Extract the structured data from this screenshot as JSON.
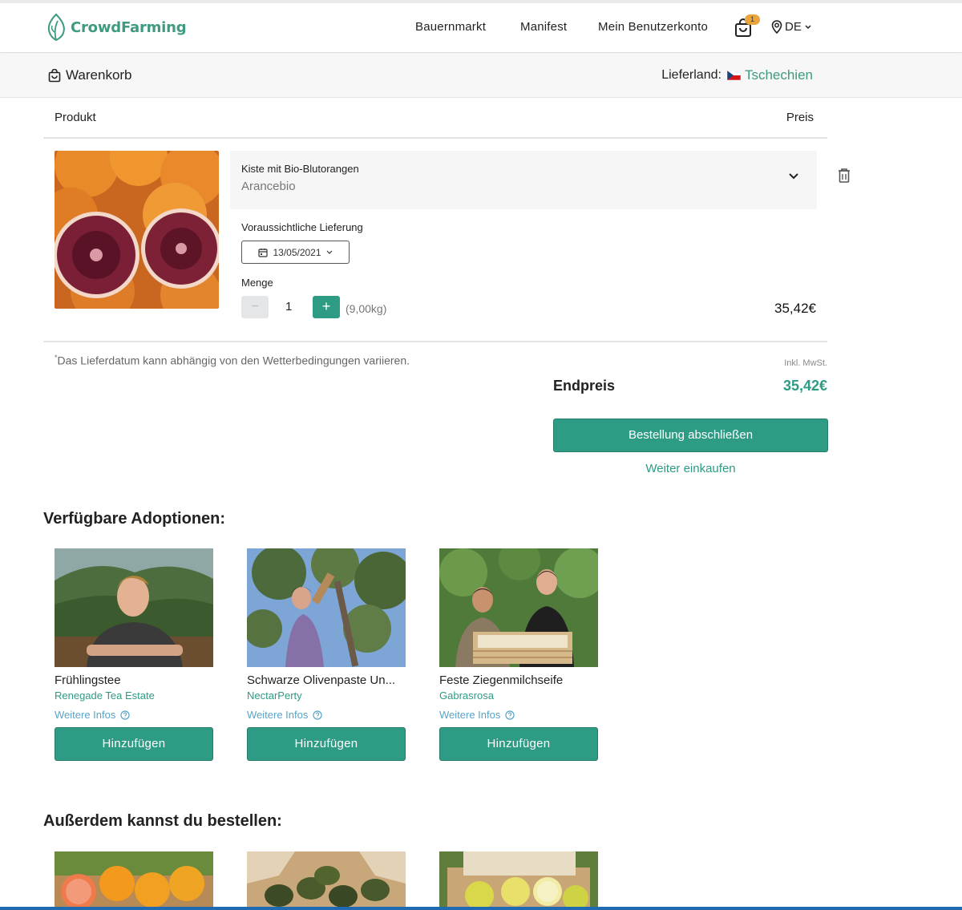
{
  "header": {
    "logo_text": "CrowdFarming",
    "nav": [
      "Bauernmarkt",
      "Manifest",
      "Mein Benutzerkonto"
    ],
    "cart_count": "1",
    "language": "DE"
  },
  "subbar": {
    "title": "Warenkorb",
    "country_label": "Lieferland:",
    "country_name": "Tschechien"
  },
  "table": {
    "col_product": "Produkt",
    "col_price": "Preis"
  },
  "cart_item": {
    "name": "Kiste mit Bio-Blutorangen",
    "farm": "Arancebio",
    "delivery_label": "Voraussichtliche Lieferung",
    "delivery_date": "13/05/2021",
    "quantity_label": "Menge",
    "minus": "−",
    "plus": "+",
    "quantity": "1",
    "weight": "(9,00kg)",
    "price": "35,42€"
  },
  "summary": {
    "footnote_mark": "*",
    "footnote": "Das Lieferdatum kann abhängig von den Wetterbedingungen variieren.",
    "vat_note": "Inkl. MwSt.",
    "total_label": "Endpreis",
    "total_value": "35,42€",
    "checkout_label": "Bestellung abschließen",
    "continue_label": "Weiter einkaufen"
  },
  "adoptions": {
    "title": "Verfügbare Adoptionen:",
    "info_label": "Weitere Infos",
    "button_label": "Hinzufügen",
    "items": [
      {
        "title": "Frühlingstee",
        "farm": "Renegade Tea Estate"
      },
      {
        "title": "Schwarze Olivenpaste Un...",
        "farm": "NectarPerty"
      },
      {
        "title": "Feste Ziegenmilchseife",
        "farm": "Gabrasrosa"
      }
    ]
  },
  "extras": {
    "title": "Außerdem kannst du bestellen:"
  },
  "colors": {
    "brand": "#2e9b84",
    "logo": "#3e9a80",
    "badge": "#e9a53b",
    "link_blue": "#5aa4c9"
  }
}
